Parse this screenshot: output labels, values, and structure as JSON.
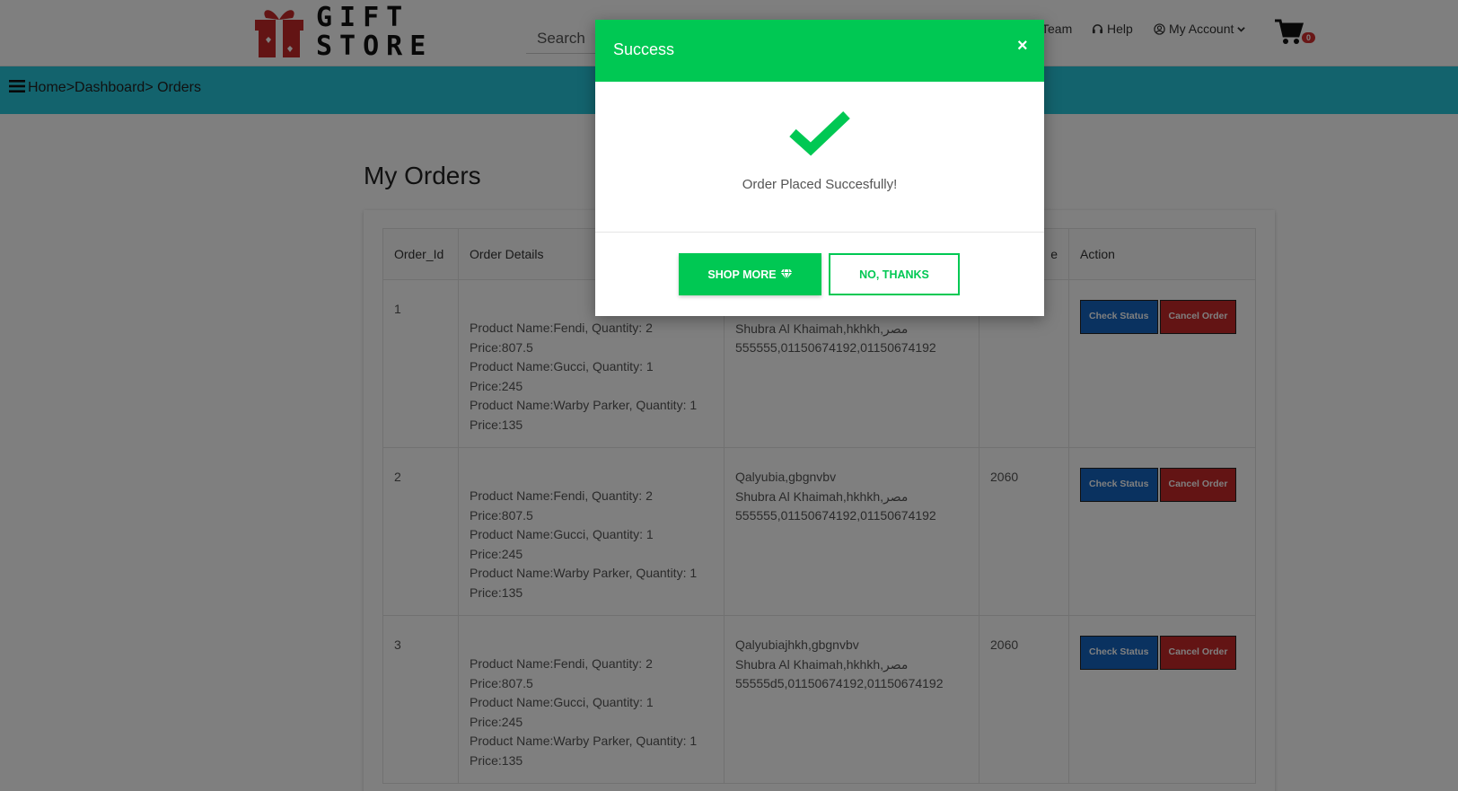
{
  "header": {
    "logo_text_line1": "GIFT",
    "logo_text_line2": "STORE",
    "search_label": "Search",
    "nav_team": "Team",
    "nav_help": "Help",
    "nav_account": "My Account",
    "cart_count": "0"
  },
  "breadcrumb": {
    "home": "Home",
    "sep1": ">",
    "dashboard": "Dashboard",
    "sep2": ">",
    "current": " Orders"
  },
  "page": {
    "title": "My Orders"
  },
  "table": {
    "headers": [
      "Order_Id",
      "Order Details",
      "",
      "e",
      "Action"
    ],
    "rows": [
      {
        "id": "1",
        "details": [
          "Product Name:Fendi, Quantity: 2",
          "Price:807.5",
          "Product Name:Gucci, Quantity: 1",
          "Price:245",
          "Product Name:Warby Parker, Quantity: 1",
          "Price:135"
        ],
        "address": [
          "",
          "Shubra Al Khaimah,hkhkh,مصر",
          "555555,01150674192,01150674192"
        ],
        "total": ""
      },
      {
        "id": "2",
        "details": [
          "Product Name:Fendi, Quantity: 2",
          "Price:807.5",
          "Product Name:Gucci, Quantity: 1",
          "Price:245",
          "Product Name:Warby Parker, Quantity: 1",
          "Price:135"
        ],
        "address": [
          "Qalyubia,gbgnvbv",
          "Shubra Al Khaimah,hkhkh,مصر",
          "555555,01150674192,01150674192"
        ],
        "total": "2060"
      },
      {
        "id": "3",
        "details": [
          "Product Name:Fendi, Quantity: 2",
          "Price:807.5",
          "Product Name:Gucci, Quantity: 1",
          "Price:245",
          "Product Name:Warby Parker, Quantity: 1",
          "Price:135"
        ],
        "address": [
          "Qalyubiajhkh,gbgnvbv",
          "Shubra Al Khaimah,hkhkh,مصر",
          "55555d5,01150674192,01150674192"
        ],
        "total": "2060"
      }
    ],
    "check_status_label": "Check Status",
    "cancel_order_label": "Cancel Order"
  },
  "modal": {
    "title": "Success",
    "close": "×",
    "message": "Order Placed Succesfully!",
    "shop_more": "SHOP MORE",
    "no_thanks": "NO, THANKS"
  },
  "colors": {
    "accent_green": "#00c853",
    "crumb_bar": "#26c6da",
    "check_status": "#1565c0",
    "cancel_order": "#c62828"
  }
}
